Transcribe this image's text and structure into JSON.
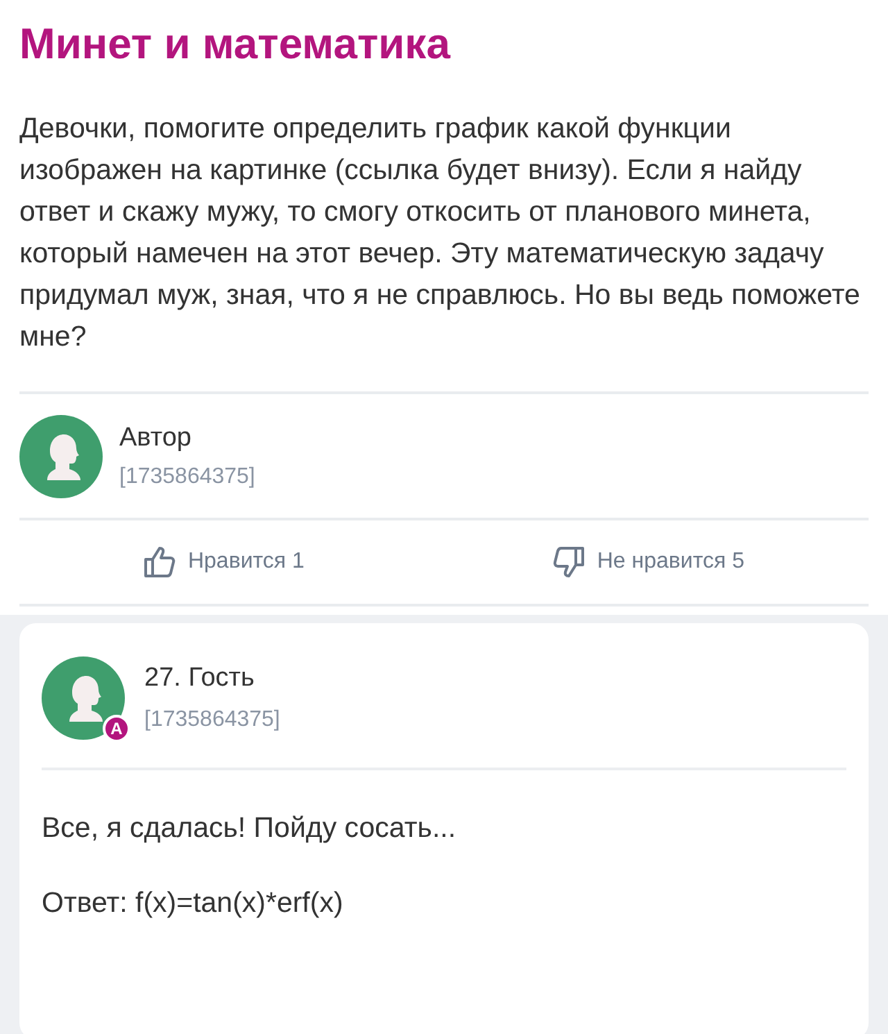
{
  "post": {
    "title": "Минет и математика",
    "body": "Девочки, помогите определить график какой функции изображен на картинке (ссылка будет внизу). Если я найду ответ и скажу мужу, то смогу откосить от планового минета, который намечен на этот вечер. Эту математическую задачу придумал муж, зная, что я не справлюсь. Но вы ведь поможете мне?",
    "author": {
      "name": "Автор",
      "id": "[1735864375]"
    },
    "like": "Нравится 1",
    "dislike": "Не нравится 5"
  },
  "comment": {
    "name": "27. Гость",
    "id": "[1735864375]",
    "badge": "A",
    "lines": [
      "Все, я сдалась! Пойду сосать...",
      "Ответ: f(x)=tan(x)*erf(x)"
    ]
  }
}
